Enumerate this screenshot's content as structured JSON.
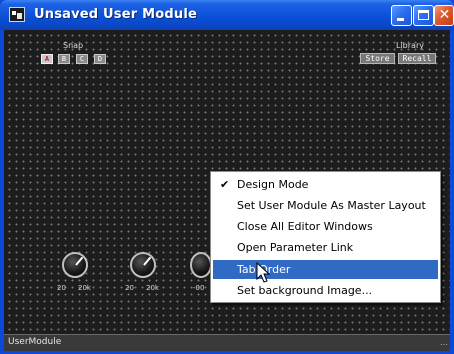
{
  "window": {
    "title": "Unsaved User Module",
    "controls": {
      "minimize": "minimize",
      "maximize": "maximize",
      "close": "✕"
    }
  },
  "snap": {
    "label": "Snap",
    "buttons": [
      "A",
      "B",
      "C",
      "D"
    ],
    "active": "A"
  },
  "library": {
    "label": "Library",
    "store_label": "Store",
    "recall_label": "Recall"
  },
  "knobs": [
    {
      "min": "20",
      "max": "20k"
    },
    {
      "min": "20",
      "max": "20k"
    },
    {
      "min": "-00",
      "max": ""
    }
  ],
  "context_menu": {
    "items": [
      {
        "label": "Design Mode",
        "checked": true
      },
      {
        "label": "Set User Module As Master Layout",
        "checked": false
      },
      {
        "label": "Close All Editor Windows",
        "checked": false
      },
      {
        "label": "Open Parameter Link",
        "checked": false
      },
      {
        "label": "Tab Order",
        "checked": false,
        "highlighted": true
      },
      {
        "label": "Set background Image...",
        "checked": false
      }
    ],
    "check_mark": "✔"
  },
  "statusbar": {
    "text": "UserModule",
    "grip": "..."
  },
  "colors": {
    "titlebar": "#0a50d6",
    "canvas": "#1d1d1d",
    "menu_highlight": "#316ac5",
    "close_button": "#e0592e"
  },
  "icons": {
    "app": "app-icon",
    "cursor": "arrow-cursor-icon"
  }
}
